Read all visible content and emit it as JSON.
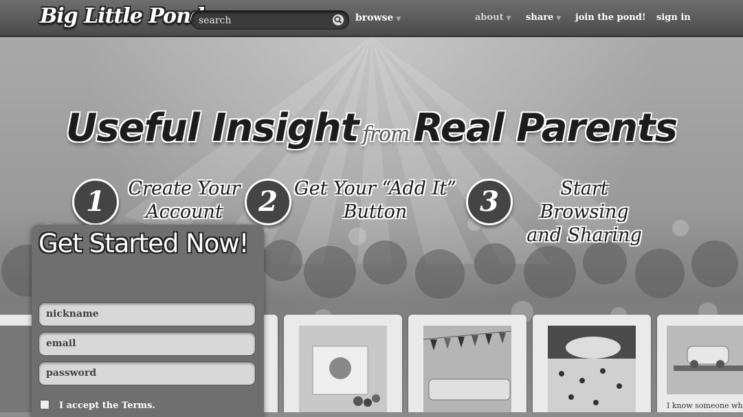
{
  "nav": {
    "logo": "Big Little Pond",
    "search_placeholder": "search",
    "browse": "browse",
    "about": "about",
    "share": "share",
    "join": "join the pond!",
    "sign_in": "sign in"
  },
  "hero": {
    "headline_a": "Useful Insight",
    "headline_from": "from",
    "headline_b": "Real Parents",
    "steps": [
      {
        "num": "1",
        "line1": "Create Your",
        "line2": "Account"
      },
      {
        "num": "2",
        "line1": "Get Your “Add It”",
        "line2": "Button"
      },
      {
        "num": "3",
        "line1": "Start Browsing",
        "line2": "and Sharing"
      }
    ]
  },
  "signup": {
    "title": "Get Started Now!",
    "nickname_placeholder": "nickname",
    "email_placeholder": "email",
    "password_placeholder": "password",
    "terms": "I accept the Terms."
  },
  "cards": {
    "last_text": "I know someone wh"
  }
}
